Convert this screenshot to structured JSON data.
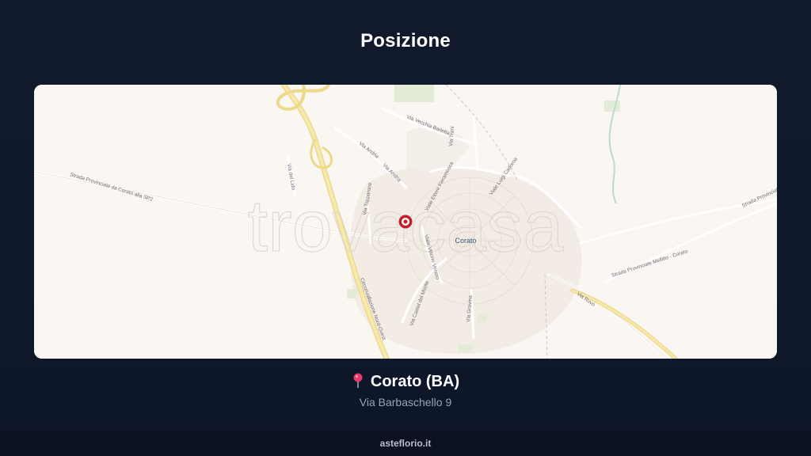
{
  "header": {
    "title": "Posizione"
  },
  "map": {
    "watermark": "trovacasa",
    "city_label": "Corato",
    "street_labels": {
      "sp_corato": "Strada Provinciale da Corato alla SP2",
      "via_andria_1": "Via Andria",
      "via_andria_2": "Via Andria",
      "via_vecchia_barletta": "Via Vecchia Barletta",
      "via_trani": "Via Trani",
      "viale_ettore_fieramosca": "Viale Ettore Fieramosca",
      "viale_luigi_cadorna": "Viale Luigi Cadorna",
      "via_del_lido": "Via del Lido",
      "via_tapparone": "Via Tapparone",
      "viale_vittorio_veneto": "Viale Vittorio Veneto",
      "via_castel_del_monte": "Via Castel del Monte",
      "via_gravina": "Via Gravina",
      "via_ruvo": "Via Ruvo",
      "sp_mellitto": "Strada Provinciale Mellitto - Corato",
      "strada_provinciale_right": "Strada Provinciale",
      "circonvallazione": "Circonvallazione Nord-Ovest"
    },
    "marker_color": "#c0202c"
  },
  "location": {
    "pin_icon": "round-pushpin-icon",
    "city": "Corato (BA)",
    "address": "Via Barbaschello 9"
  },
  "footer": {
    "site": "asteflorio.it"
  },
  "colors": {
    "background": "#111a2c",
    "map_bg": "#faf6f2",
    "major_road": "#f3e3a0",
    "marker": "#c0202c"
  }
}
